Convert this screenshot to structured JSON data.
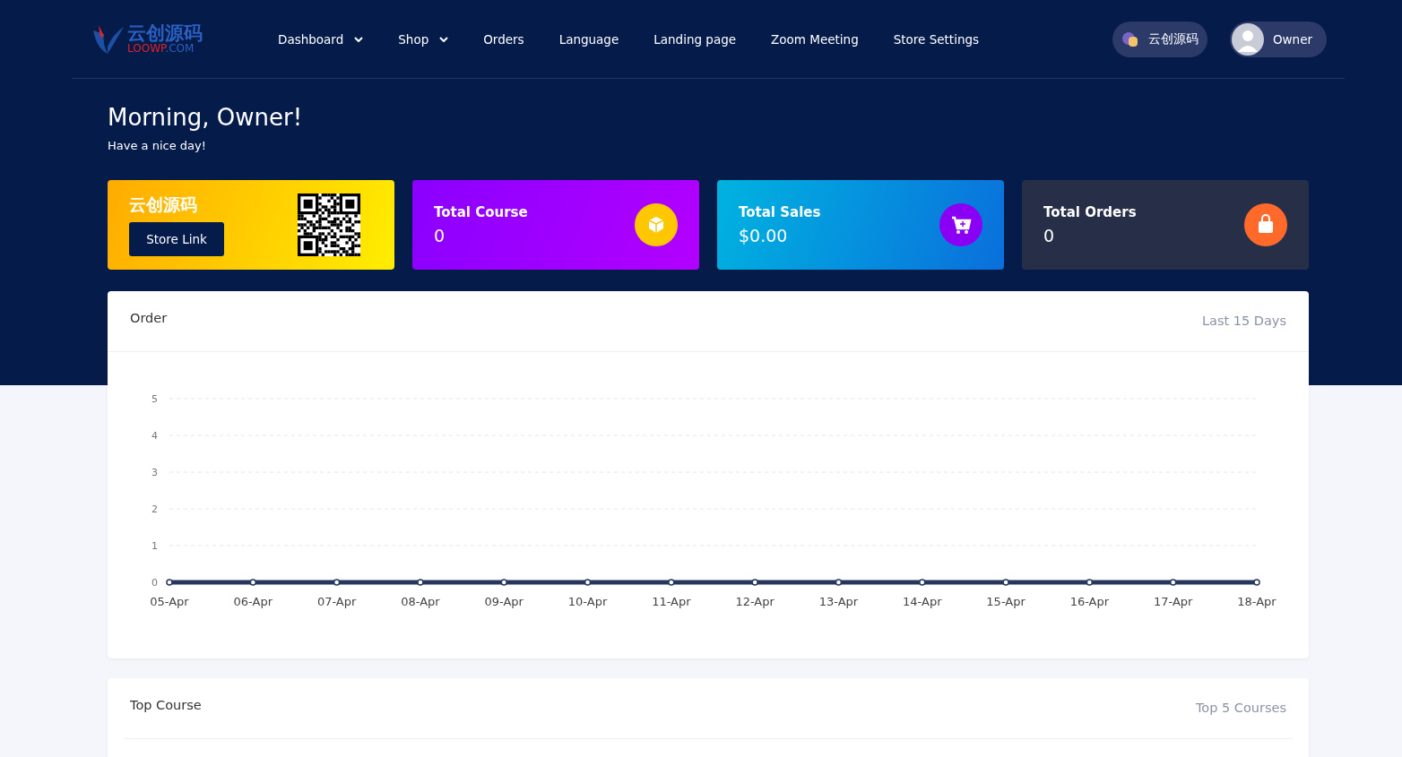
{
  "logo": {
    "name": "云创源码",
    "domain_a": "LOOWP",
    "domain_b": ".COM"
  },
  "nav": [
    {
      "label": "Dashboard",
      "has_dropdown": true
    },
    {
      "label": "Shop",
      "has_dropdown": true
    },
    {
      "label": "Orders",
      "has_dropdown": false
    },
    {
      "label": "Language",
      "has_dropdown": false
    },
    {
      "label": "Landing page",
      "has_dropdown": false
    },
    {
      "label": "Zoom Meeting",
      "has_dropdown": false
    },
    {
      "label": "Store Settings",
      "has_dropdown": false
    }
  ],
  "store_pill": {
    "label": "云创源码"
  },
  "user": {
    "name": "Owner"
  },
  "greeting": {
    "title": "Morning, Owner!",
    "subtitle": "Have a nice day!"
  },
  "cards": [
    {
      "kind": "store",
      "title": "云创源码",
      "button": "Store Link"
    },
    {
      "kind": "course",
      "title": "Total Course",
      "value": "0"
    },
    {
      "kind": "sales",
      "title": "Total Sales",
      "value": "$0.00"
    },
    {
      "kind": "orders",
      "title": "Total Orders",
      "value": "0"
    }
  ],
  "order_panel": {
    "title": "Order",
    "range": "Last 15 Days",
    "chart_data": {
      "type": "line",
      "categories": [
        "05-Apr",
        "06-Apr",
        "07-Apr",
        "08-Apr",
        "09-Apr",
        "10-Apr",
        "11-Apr",
        "12-Apr",
        "13-Apr",
        "14-Apr",
        "15-Apr",
        "16-Apr",
        "17-Apr",
        "18-Apr"
      ],
      "series": [
        {
          "color": "#26375f",
          "marker": true,
          "values": [
            0,
            0,
            0,
            0,
            0,
            0,
            0,
            0,
            0,
            0,
            0,
            0,
            0,
            0
          ]
        }
      ],
      "ylim": [
        0,
        5
      ],
      "yticks": [
        0,
        1,
        2,
        3,
        4,
        5
      ],
      "grid": true
    }
  },
  "top_course_panel": {
    "title": "Top Course",
    "range": "Top 5 Courses"
  }
}
